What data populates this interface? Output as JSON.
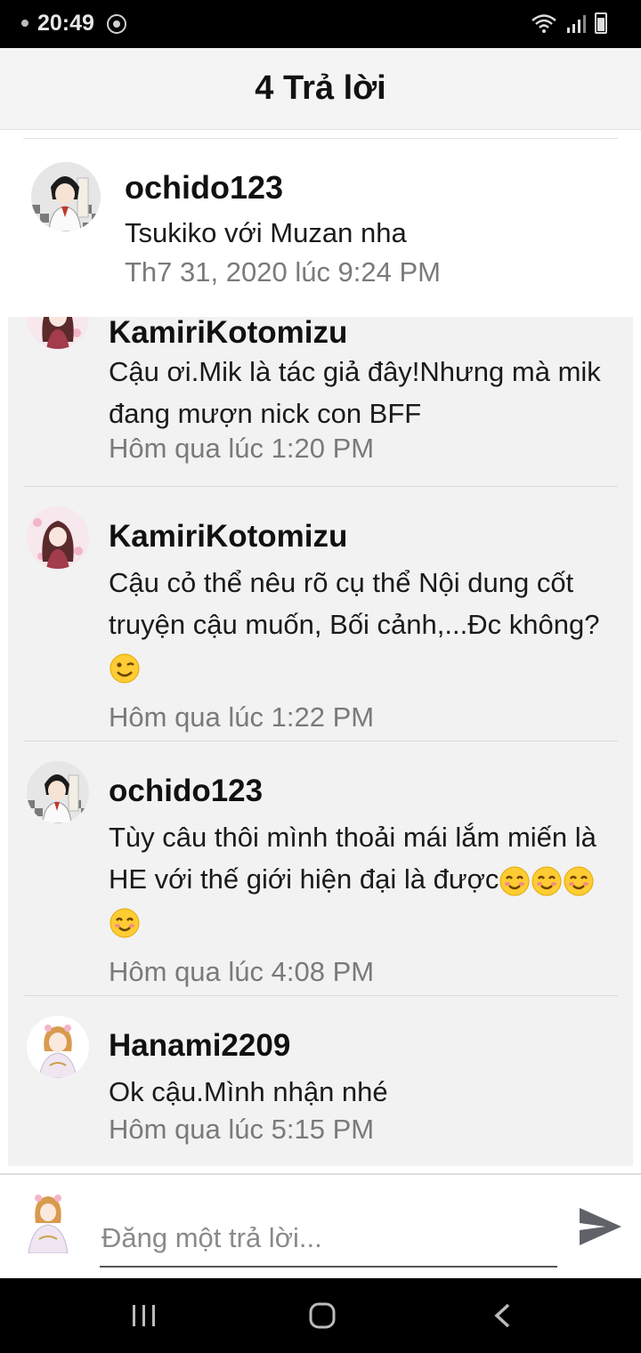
{
  "status_bar": {
    "time": "20:49",
    "icons": [
      "app-notification-icon",
      "wifi-icon",
      "signal-icon",
      "battery-icon"
    ]
  },
  "header": {
    "title": "4 Trả lời"
  },
  "original_post": {
    "username": "ochido123",
    "text": "Tsukiko với Muzan nha",
    "timestamp": "Th7 31, 2020 lúc 9:24 PM"
  },
  "replies": [
    {
      "username": "KamiriKotomizu",
      "text": "Cậu ơi.Mik là tác giả đây!Nhưng mà mik đang mượn nick con BFF",
      "timestamp": "Hôm qua lúc 1:20 PM"
    },
    {
      "username": "KamiriKotomizu",
      "text": "Cậu cỏ thể nêu rõ cụ thể Nội dung cốt truyện cậu muốn, Bối cảnh,...Đc không?",
      "emoji": "winking-face",
      "timestamp": "Hôm qua lúc 1:22 PM"
    },
    {
      "username": "ochido123",
      "text": "Tùy câu thôi mình thoải mái lắm miến là HE với thế giới hiện đại là được",
      "emoji": "smiling-face x4",
      "timestamp": "Hôm qua lúc 4:08 PM"
    },
    {
      "username": "Hanami2209",
      "text": "Ok cậu.Mình nhận nhé",
      "timestamp": "Hôm qua lúc 5:15 PM"
    }
  ],
  "compose": {
    "placeholder": "Đăng một trả lời..."
  },
  "nav_bar": {
    "buttons": [
      "recents-icon",
      "home-icon",
      "back-icon"
    ]
  },
  "colors": {
    "header_bg": "#f4f4f4",
    "reply_list_bg": "#f2f2f2",
    "timestamp": "#7a7a7a",
    "text": "#1a1a1a"
  }
}
